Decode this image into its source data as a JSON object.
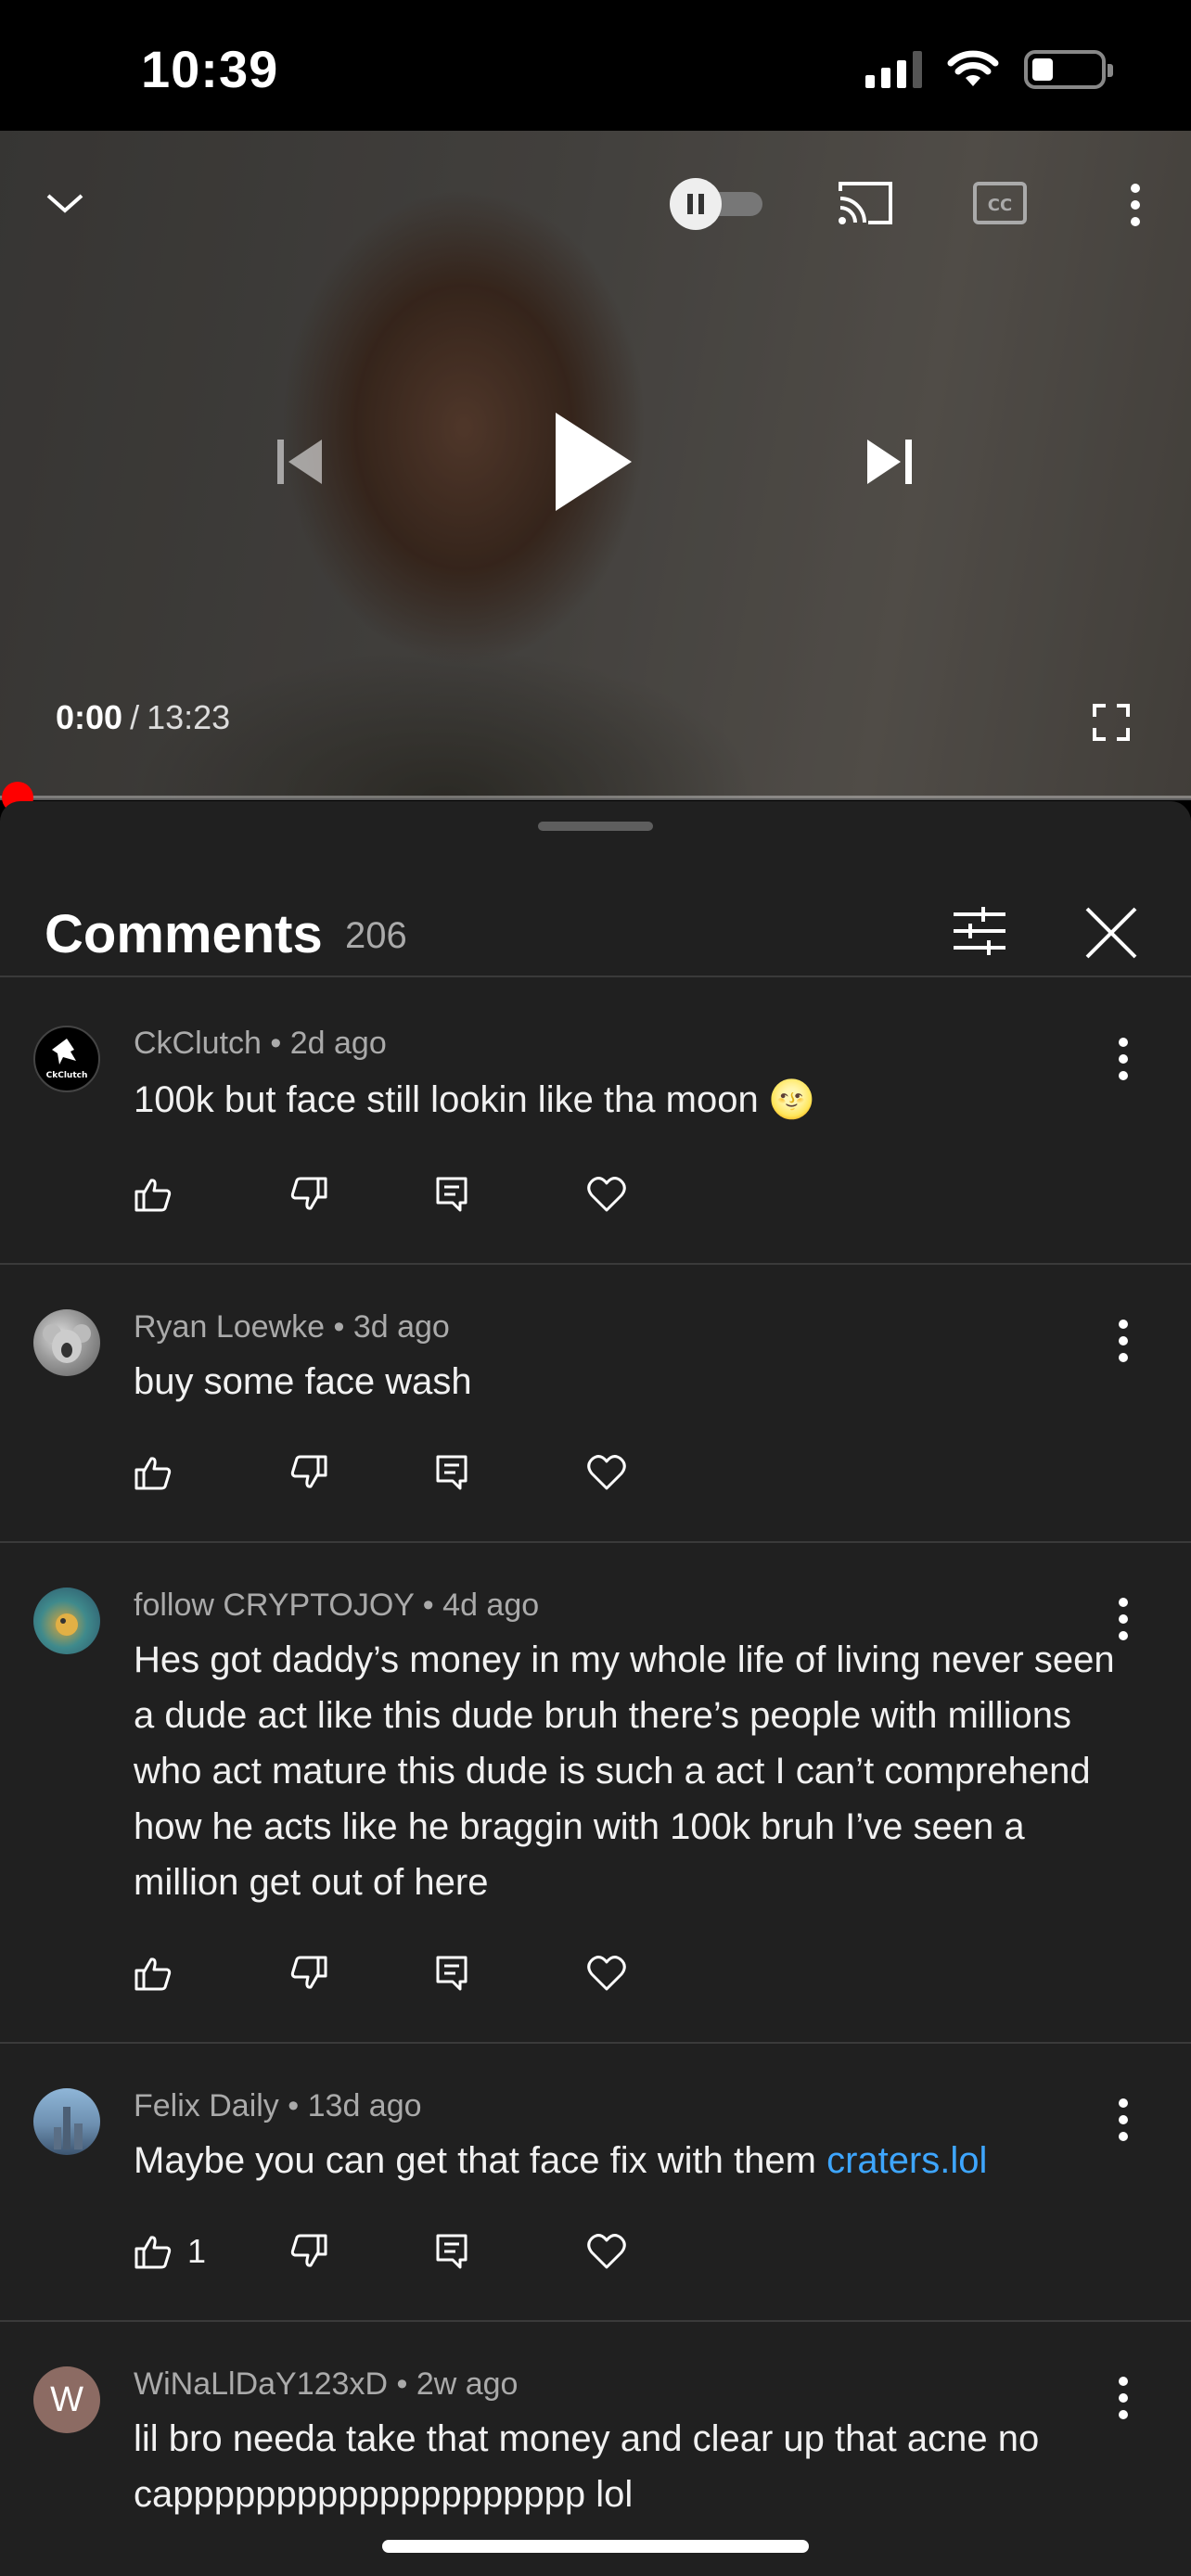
{
  "status_bar": {
    "time": "10:39"
  },
  "player": {
    "current_time": "0:00",
    "separator": "/",
    "duration": "13:23",
    "progress": 0.0,
    "autoplay": "paused"
  },
  "comments_panel": {
    "title": "Comments",
    "count": "206"
  },
  "comments": [
    {
      "author": "CkClutch",
      "age": "2d ago",
      "text": "100k but face still lookin like tha moon 🌝",
      "likes": "",
      "avatar": "CkClutch"
    },
    {
      "author": "Ryan Loewke",
      "age": "3d ago",
      "text": "buy some face wash",
      "likes": "",
      "avatar": ""
    },
    {
      "author": "follow CRYPTOJOY",
      "age": "4d ago",
      "text": "Hes got daddy’s money in my whole life of living never seen a dude act like this dude bruh there’s people with millions who act mature this dude is such a act I can’t comprehend how he acts like he braggin with 100k bruh I’ve seen a million get out of here",
      "likes": "",
      "avatar": ""
    },
    {
      "author": "Felix Daily",
      "age": "13d ago",
      "text": "Maybe you can get that face fix with them ",
      "link": "craters.lol",
      "likes": "1",
      "avatar": ""
    },
    {
      "author": "WiNaLlDaY123xD",
      "age": "2w ago",
      "text": "lil bro needa take that money and clear up that acne no capppppppppppppppppppp lol",
      "likes": "",
      "avatar": "W"
    }
  ],
  "meta_separator": "•",
  "colors": {
    "accent_red": "#ff0000",
    "link_blue": "#3ea6ff",
    "panel_bg": "#202020"
  },
  "icons": [
    "chevron-down-icon",
    "autoplay-toggle-icon",
    "cast-icon",
    "captions-icon",
    "more-vert-icon",
    "previous-icon",
    "play-icon",
    "next-icon",
    "fullscreen-icon",
    "filter-icon",
    "close-icon",
    "thumb-up-icon",
    "thumb-down-icon",
    "reply-icon",
    "heart-icon"
  ]
}
